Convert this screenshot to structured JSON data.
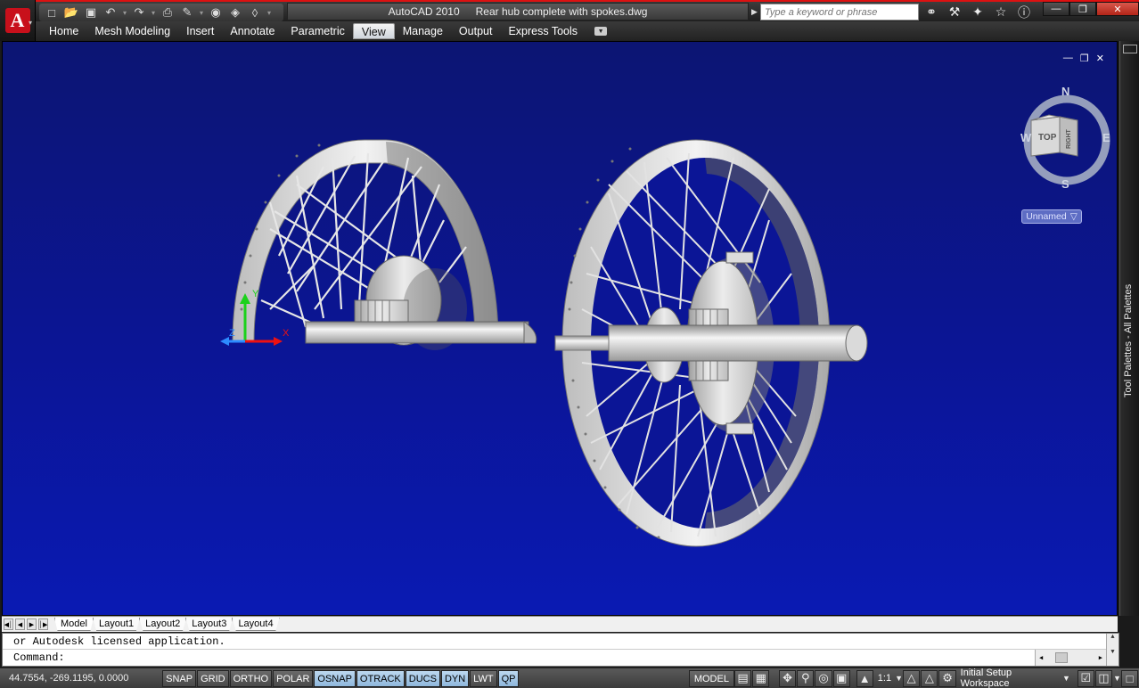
{
  "titlebar": {
    "app_name": "AutoCAD 2010",
    "document_name": "Rear hub complete with spokes.dwg",
    "app_button_letter": "A",
    "search_placeholder": "Type a keyword or phrase",
    "quick_access_icons": [
      "new-icon",
      "open-icon",
      "save-icon",
      "undo-icon",
      "redo-icon",
      "plot-icon",
      "publish-icon",
      "layer-icon",
      "match-properties-icon",
      "workspace-icon"
    ],
    "info_icons": [
      "binoculars-icon",
      "communication-center-icon",
      "satellite-icon",
      "favorites-star-icon",
      "help-icon"
    ],
    "window_controls": [
      "minimize",
      "restore",
      "close"
    ]
  },
  "ribbon": {
    "tabs": [
      "Home",
      "Mesh Modeling",
      "Insert",
      "Annotate",
      "Parametric",
      "View",
      "Manage",
      "Output",
      "Express Tools"
    ],
    "active_tab": "View"
  },
  "viewport": {
    "controls": [
      "minimize",
      "restore",
      "close"
    ],
    "viewcube": {
      "top": "TOP",
      "right": "RIGHT",
      "n": "N",
      "s": "S",
      "e": "E",
      "w": "W"
    },
    "ucs_label": "Unnamed",
    "ucs_axes": {
      "x": "X",
      "y": "Y",
      "z": "Z"
    },
    "colors": {
      "background_top": "#0c1573",
      "background_bottom": "#0a1ab3",
      "model": "#d9d9d9"
    }
  },
  "palette": {
    "label": "Tool Palettes - All Palettes"
  },
  "layout_tabs": {
    "tabs": [
      "Model",
      "Layout1",
      "Layout2",
      "Layout3",
      "Layout4"
    ],
    "active": "Model"
  },
  "command": {
    "history_line": "or Autodesk licensed application.",
    "prompt": "Command:"
  },
  "status": {
    "coords": "44.7554,  -269.1195, 0.0000",
    "toggles": [
      {
        "label": "SNAP",
        "on": false
      },
      {
        "label": "GRID",
        "on": false
      },
      {
        "label": "ORTHO",
        "on": false
      },
      {
        "label": "POLAR",
        "on": false
      },
      {
        "label": "OSNAP",
        "on": true
      },
      {
        "label": "OTRACK",
        "on": true
      },
      {
        "label": "DUCS",
        "on": true
      },
      {
        "label": "DYN",
        "on": true
      },
      {
        "label": "LWT",
        "on": false
      },
      {
        "label": "QP",
        "on": true
      }
    ],
    "model_label": "MODEL",
    "scale": "1:1",
    "workspace": "Initial Setup Workspace"
  }
}
